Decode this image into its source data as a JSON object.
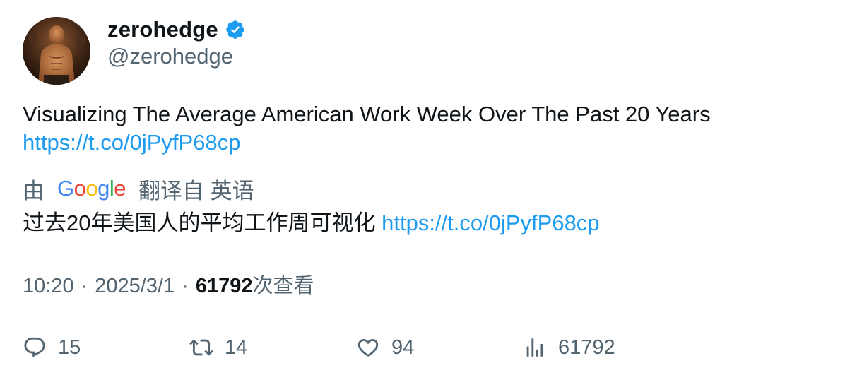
{
  "author": {
    "display_name": "zerohedge",
    "handle": "@zerohedge",
    "verified": true
  },
  "tweet": {
    "text": "Visualizing The Average American Work Week Over The Past 20 Years",
    "link": "https://t.co/0jPyfP68cp"
  },
  "translation": {
    "by_label": "由",
    "provider": "Google",
    "from_label": "翻译自 英语",
    "text": "过去20年美国人的平均工作周可视化",
    "link": "https://t.co/0jPyfP68cp"
  },
  "meta": {
    "time": "10:20",
    "separator": "·",
    "date": "2025/3/1",
    "views_count": "61792",
    "views_label": "次查看"
  },
  "actions": {
    "replies": "15",
    "retweets": "14",
    "likes": "94",
    "views": "61792"
  },
  "icons": {
    "verified": "verified-badge-icon",
    "reply": "reply-icon",
    "retweet": "retweet-icon",
    "like": "heart-icon",
    "views": "analytics-icon"
  },
  "colors": {
    "link": "#1d9bf0",
    "secondary_text": "#536471",
    "primary_text": "#0f1419",
    "verified": "#1d9bf0"
  }
}
